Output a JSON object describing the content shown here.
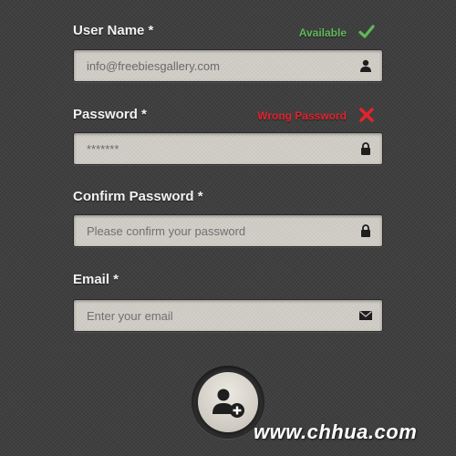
{
  "form": {
    "username": {
      "label": "User Name *",
      "value": "info@freebiesgallery.com",
      "status": "Available",
      "status_icon": "check-icon",
      "field_icon": "user-icon"
    },
    "password": {
      "label": "Password *",
      "value": "*******",
      "status": "Wrong Password",
      "status_icon": "cross-icon",
      "field_icon": "lock-icon"
    },
    "confirm_password": {
      "label": "Confirm Password *",
      "placeholder": "Please confirm your password",
      "field_icon": "lock-icon"
    },
    "email": {
      "label": "Email *",
      "placeholder": "Enter your email",
      "field_icon": "envelope-icon"
    },
    "submit": {
      "icon": "add-user-icon"
    }
  },
  "watermark": "www.chhua.com",
  "colors": {
    "background": "#3f3f3f",
    "field": "#cfccc5",
    "success": "#5fb85a",
    "error": "#e0242c",
    "label": "#f2f2f2"
  }
}
